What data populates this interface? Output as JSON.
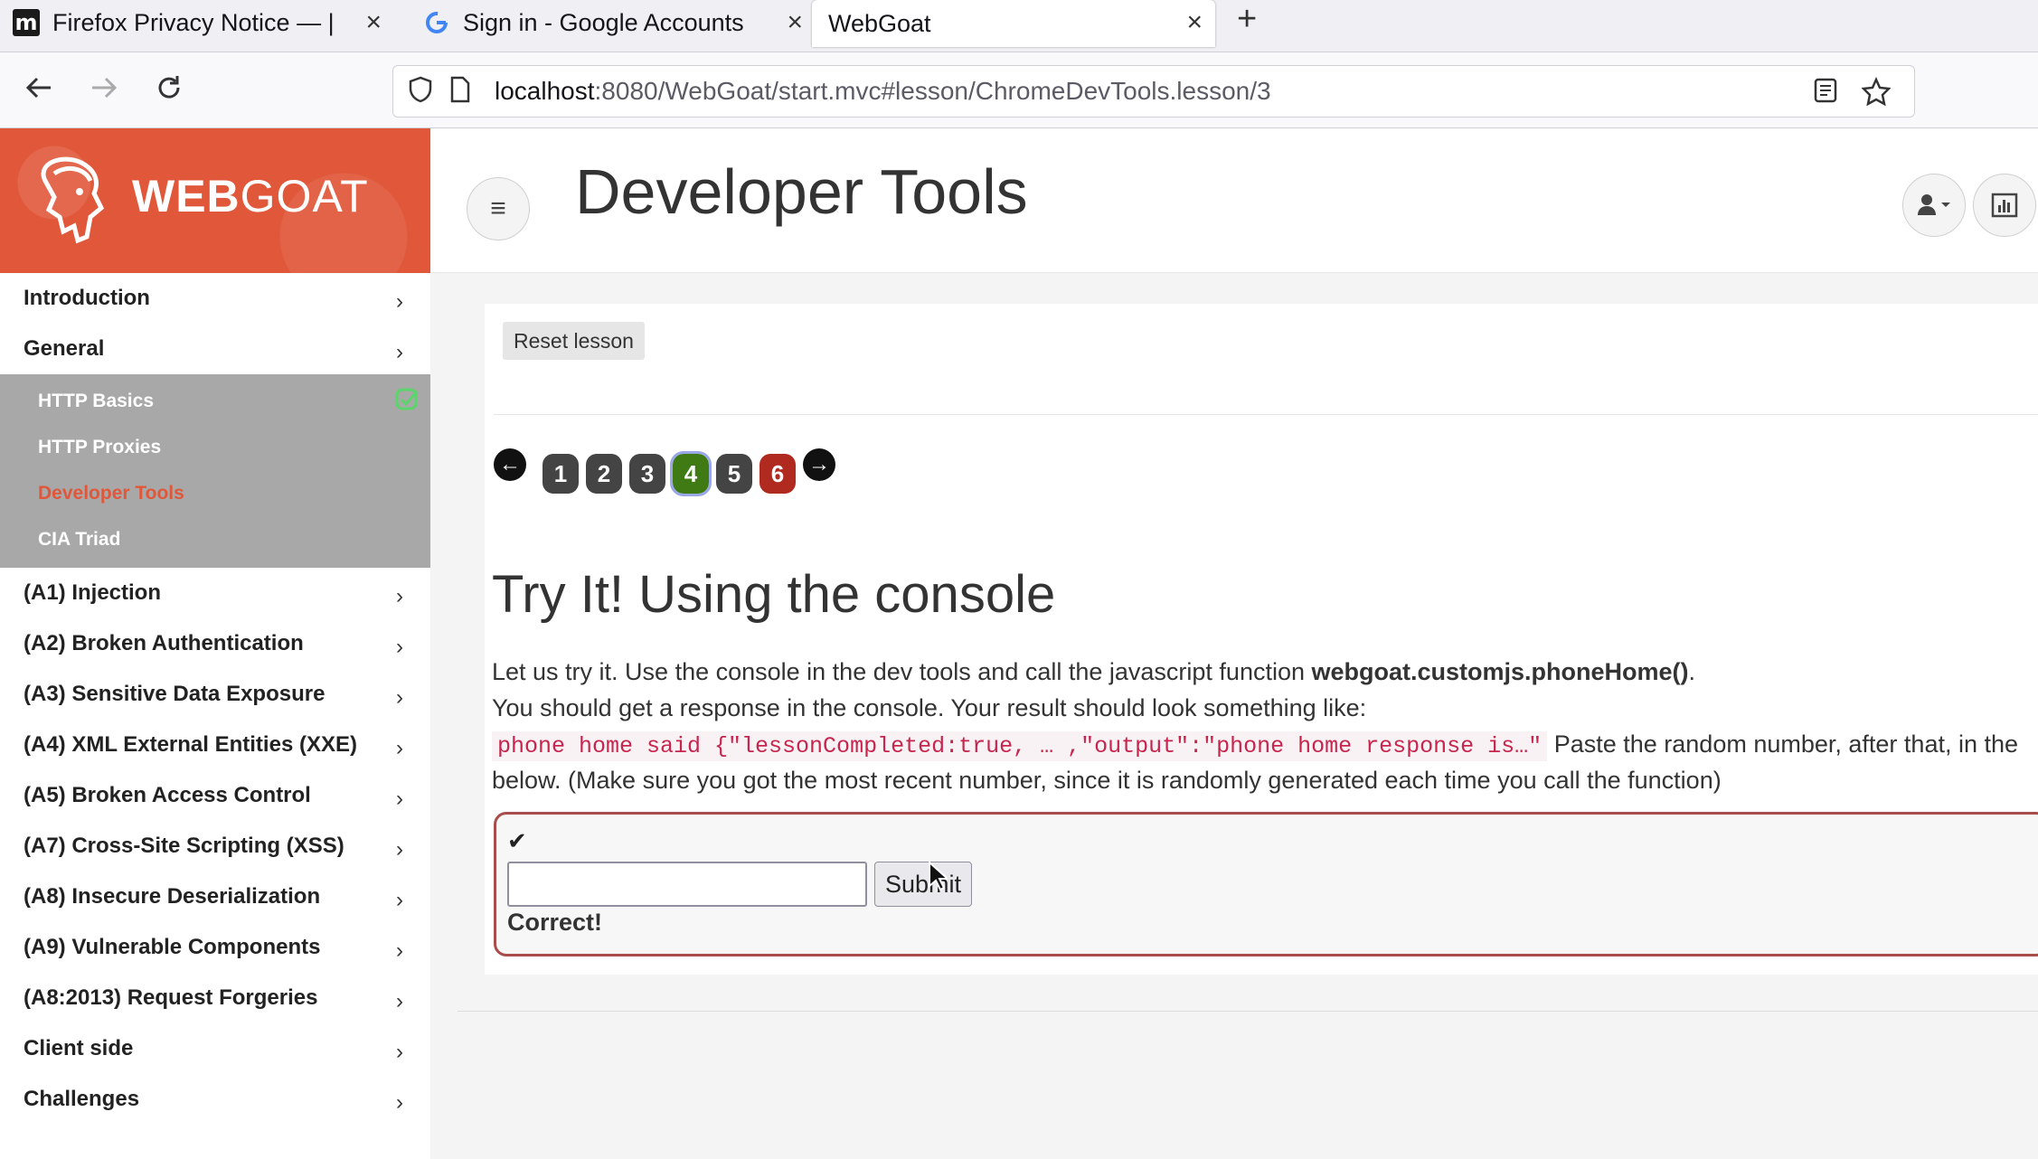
{
  "browser": {
    "tabs": [
      {
        "title": "Firefox Privacy Notice — |",
        "favicon": "mozilla-m-icon"
      },
      {
        "title": "Sign in - Google Accounts",
        "favicon": "google-g-icon"
      },
      {
        "title": "WebGoat",
        "favicon": "none"
      }
    ],
    "url_host": "localhost",
    "url_rest": ":8080/WebGoat/start.mvc#lesson/ChromeDevTools.lesson/3"
  },
  "sidebar": {
    "logo_bold": "WEB",
    "logo_regular": "GOAT",
    "categories": [
      {
        "label": "Introduction"
      },
      {
        "label": "General"
      },
      {
        "label": "(A1) Injection"
      },
      {
        "label": "(A2) Broken Authentication"
      },
      {
        "label": "(A3) Sensitive Data Exposure"
      },
      {
        "label": "(A4) XML External Entities (XXE)"
      },
      {
        "label": "(A5) Broken Access Control"
      },
      {
        "label": "(A7) Cross-Site Scripting (XSS)"
      },
      {
        "label": "(A8) Insecure Deserialization"
      },
      {
        "label": "(A9) Vulnerable Components"
      },
      {
        "label": "(A8:2013) Request Forgeries"
      },
      {
        "label": "Client side"
      },
      {
        "label": "Challenges"
      }
    ],
    "general_lessons": [
      {
        "label": "HTTP Basics",
        "completed": true
      },
      {
        "label": "HTTP Proxies",
        "completed": false
      },
      {
        "label": "Developer Tools",
        "current": true
      },
      {
        "label": "CIA Triad",
        "completed": false
      }
    ]
  },
  "header": {
    "title": "Developer Tools"
  },
  "lesson": {
    "reset_label": "Reset lesson",
    "pages": [
      "1",
      "2",
      "3",
      "4",
      "5",
      "6"
    ],
    "current_page": "4",
    "heading": "Try It! Using the console",
    "line1_pre": "Let us try it. Use the console in the dev tools and call the javascript function ",
    "line1_bold": "webgoat.customjs.phoneHome()",
    "line1_post": ".",
    "line2": "You should get a response in the console. Your result should look something like:",
    "code_sample": "phone home said {\"lessonCompleted:true, … ,\"output\":\"phone home response is…\"",
    "line3_post": " Paste the random number, after that, in the",
    "line4": "below. (Make sure you got the most recent number, since it is randomly generated each time you call the function)",
    "answer_value": "",
    "submit_label": "Submit",
    "feedback": "Correct!"
  },
  "colors": {
    "brand": "#e0573a",
    "completed_page": "#3f7a14",
    "error_page": "#b02a1f",
    "attack_border": "#a84c4c"
  }
}
